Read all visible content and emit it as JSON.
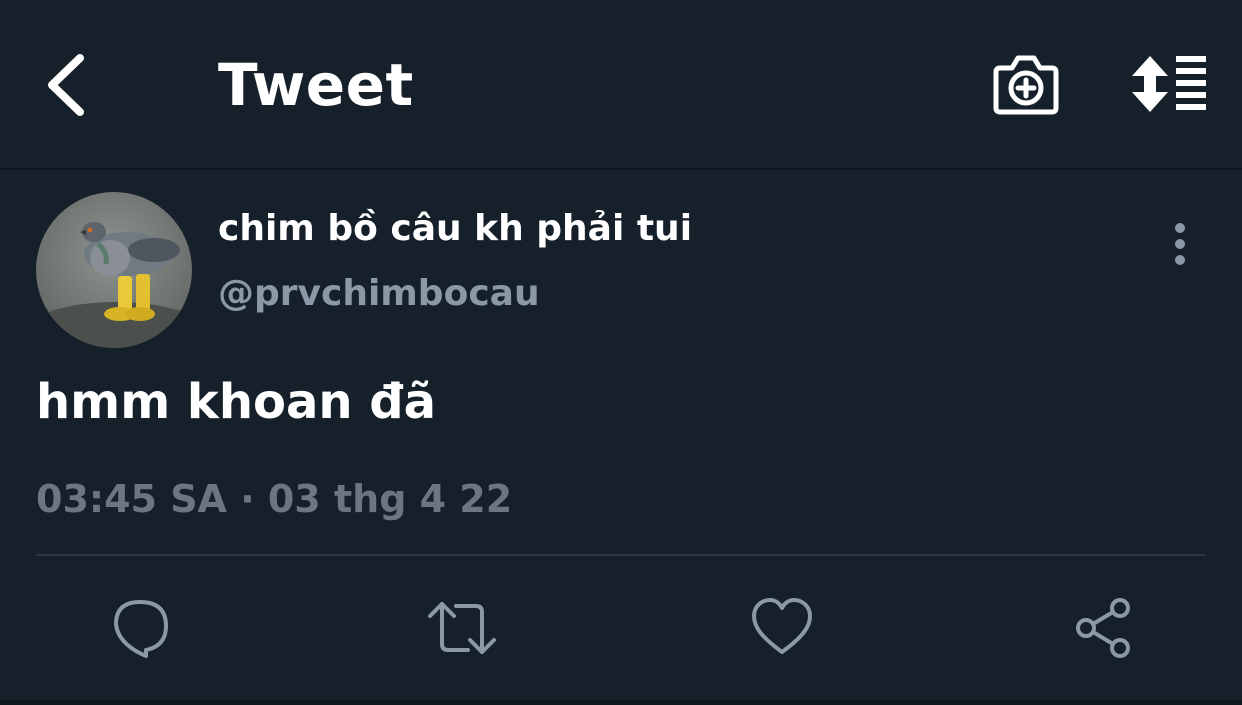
{
  "header": {
    "back_icon": "chevron-left-icon",
    "title": "Tweet",
    "camera_icon": "camera-plus-icon",
    "sort_icon": "sort-list-icon"
  },
  "tweet": {
    "author": {
      "display_name": "chim bồ câu kh phải tui",
      "handle": "@prvchimbocau",
      "avatar_icon": "pigeon-avatar"
    },
    "more_icon": "more-vertical-icon",
    "text": "hmm khoan đã",
    "timestamp": "03:45 SA · 03 thg 4 22"
  },
  "actions": [
    {
      "icon": "reply-icon"
    },
    {
      "icon": "retweet-icon"
    },
    {
      "icon": "heart-icon"
    },
    {
      "icon": "share-icon"
    }
  ],
  "colors": {
    "background": "#15202b",
    "text_primary": "#ffffff",
    "text_secondary": "#8b98a5",
    "timestamp": "#6b7682",
    "divider": "#2b3640",
    "icon": "#8b98a5"
  }
}
